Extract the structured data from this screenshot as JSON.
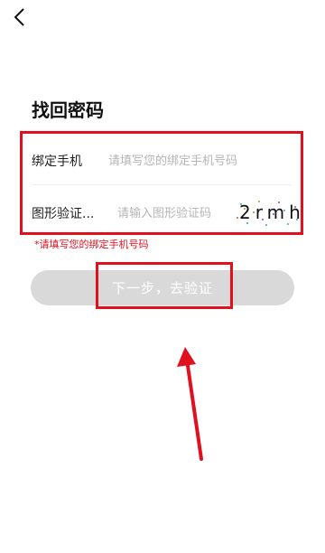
{
  "header": {
    "back_icon": "chevron-left-icon"
  },
  "page_title": "找回密码",
  "form": {
    "phone": {
      "label": "绑定手机",
      "placeholder": "请填写您的绑定手机号码",
      "value": ""
    },
    "captcha_field": {
      "label": "图形验证...",
      "placeholder": "请输入图形验证码",
      "value": ""
    },
    "captcha_image_text": "2rmh"
  },
  "error_message": "*请填写您的绑定手机号码",
  "next_button": {
    "label": "下一步，去验证"
  },
  "colors": {
    "annotation_red": "#e0101e",
    "button_disabled": "#d9d9d9",
    "placeholder": "#b5b5b5"
  }
}
